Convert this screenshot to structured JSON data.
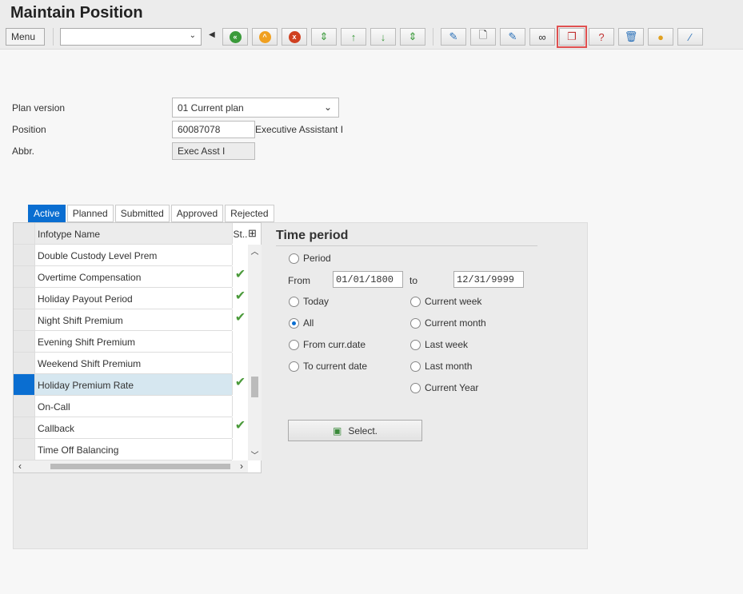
{
  "title": "Maintain Position",
  "toolbar": {
    "menu": "Menu",
    "command_value": "",
    "buttons": [
      "back",
      "exit",
      "cancel",
      "first",
      "previous",
      "next",
      "last",
      "pick-change",
      "create",
      "change",
      "display",
      "copy",
      "delimit",
      "delete",
      "overview",
      "wand"
    ],
    "highlighted": "copy"
  },
  "form": {
    "plan_version_label": "Plan version",
    "plan_version": "01 Current plan",
    "position_label": "Position",
    "position": "60087078",
    "position_text": "Executive Assistant I",
    "abbr_label": "Abbr.",
    "abbr": "Exec Asst I"
  },
  "tabs": [
    "Active",
    "Planned",
    "Submitted",
    "Approved",
    "Rejected"
  ],
  "table": {
    "col_name": "Infotype Name",
    "col_status": "St..",
    "rows": [
      {
        "name": "Double Custody Level Prem",
        "check": false
      },
      {
        "name": "Overtime Compensation",
        "check": true
      },
      {
        "name": "Holiday Payout Period",
        "check": true
      },
      {
        "name": "Night Shift Premium",
        "check": true
      },
      {
        "name": "Evening Shift Premium",
        "check": false
      },
      {
        "name": "Weekend Shift Premium",
        "check": false
      },
      {
        "name": "Holiday Premium Rate",
        "check": true
      },
      {
        "name": "On-Call",
        "check": false
      },
      {
        "name": "Callback",
        "check": true
      },
      {
        "name": "Time Off Balancing",
        "check": false
      }
    ]
  },
  "time_period": {
    "title": "Time period",
    "period": "Period",
    "from_label": "From",
    "from": "01/01/1800",
    "to_label": "to",
    "to": "12/31/9999",
    "left": [
      "Today",
      "All",
      "From curr.date",
      "To current date"
    ],
    "right": [
      "Current week",
      "Current month",
      "Last week",
      "Last month",
      "Current Year"
    ],
    "selected": "All",
    "select_button": "Select."
  }
}
